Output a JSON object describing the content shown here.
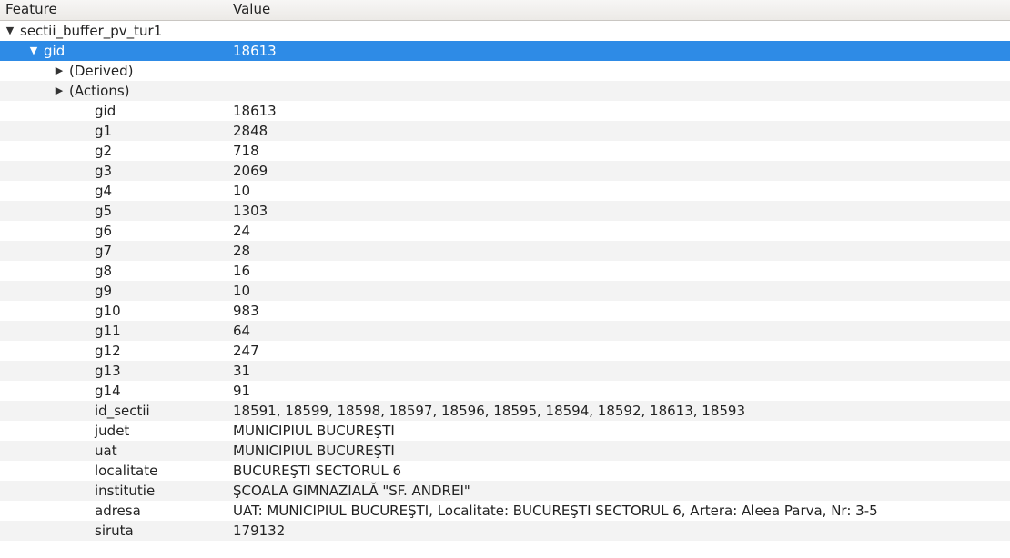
{
  "header": {
    "feature": "Feature",
    "value": "Value"
  },
  "tree": {
    "layer": {
      "name": "sectii_buffer_pv_tur1",
      "expanded": true
    },
    "selected": {
      "key": "gid",
      "value": "18613"
    },
    "groups": [
      {
        "name": "(Derived)",
        "expanded": false
      },
      {
        "name": "(Actions)",
        "expanded": false
      }
    ],
    "attributes": [
      {
        "key": "gid",
        "value": "18613"
      },
      {
        "key": "g1",
        "value": "2848"
      },
      {
        "key": "g2",
        "value": "718"
      },
      {
        "key": "g3",
        "value": "2069"
      },
      {
        "key": "g4",
        "value": "10"
      },
      {
        "key": "g5",
        "value": "1303"
      },
      {
        "key": "g6",
        "value": "24"
      },
      {
        "key": "g7",
        "value": "28"
      },
      {
        "key": "g8",
        "value": "16"
      },
      {
        "key": "g9",
        "value": "10"
      },
      {
        "key": "g10",
        "value": "983"
      },
      {
        "key": "g11",
        "value": "64"
      },
      {
        "key": "g12",
        "value": "247"
      },
      {
        "key": "g13",
        "value": "31"
      },
      {
        "key": "g14",
        "value": "91"
      },
      {
        "key": "id_sectii",
        "value": "18591, 18599, 18598, 18597, 18596, 18595, 18594, 18592, 18613, 18593"
      },
      {
        "key": "judet",
        "value": "MUNICIPIUL BUCUREŞTI"
      },
      {
        "key": "uat",
        "value": "MUNICIPIUL BUCUREŞTI"
      },
      {
        "key": "localitate",
        "value": "BUCUREŞTI SECTORUL 6"
      },
      {
        "key": "institutie",
        "value": "ŞCOALA GIMNAZIALĂ \"SF. ANDREI\""
      },
      {
        "key": "adresa",
        "value": "UAT: MUNICIPIUL BUCUREŞTI, Localitate: BUCUREŞTI SECTORUL 6, Artera: Aleea Parva, Nr: 3-5"
      },
      {
        "key": "siruta",
        "value": "179132"
      }
    ]
  },
  "glyphs": {
    "expanded": "▼",
    "collapsed": "▶"
  }
}
